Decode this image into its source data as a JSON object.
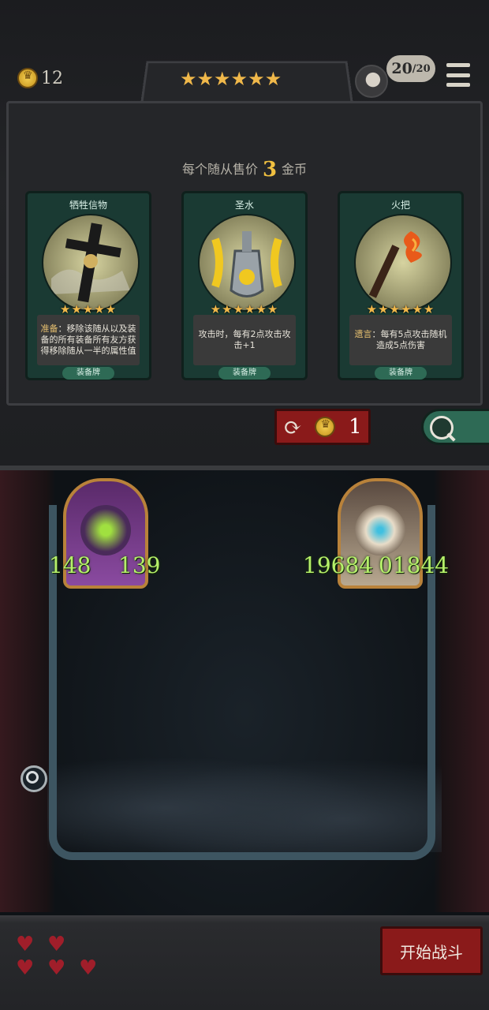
{
  "header": {
    "gold": "12",
    "tavern_stars": "★★★★★★",
    "roster_count": "20",
    "roster_max": "/20"
  },
  "shop": {
    "sell_prefix": "每个随从售价",
    "sell_price": "3",
    "sell_suffix": "金币",
    "cards": [
      {
        "name": "牺牲信物",
        "stars": "★★★★★",
        "desc_keyword": "准备",
        "desc": "：移除该随从以及装备的所有装备所有友方获得移除随从一半的属性值",
        "type": "装备牌"
      },
      {
        "name": "圣水",
        "stars": "★★★★★★",
        "desc_keyword": "",
        "desc": "攻击时，每有2点攻击攻击+1",
        "type": "装备牌"
      },
      {
        "name": "火把",
        "stars": "★★★★★★",
        "desc_keyword": "遗言",
        "desc": "：每有5点攻击随机造成5点伤害",
        "type": "装备牌"
      }
    ],
    "refresh_cost": "1"
  },
  "board": {
    "minions": [
      {
        "attack": "148",
        "health": "139"
      },
      {
        "attack": "19684",
        "health": "01844"
      }
    ]
  },
  "footer": {
    "lives": [
      true,
      true,
      true,
      true,
      true
    ],
    "start_label": "开始战斗"
  },
  "colors": {
    "accent_gold": "#f0b84a",
    "card_green": "#2e6a55",
    "button_red": "#8a1a1a",
    "stat_green": "#b6f06a"
  },
  "icons": [
    "coin-icon",
    "star-icon",
    "avatar-icon",
    "menu-icon",
    "refresh-icon",
    "search-icon",
    "zoom-icon",
    "heart-icon"
  ]
}
